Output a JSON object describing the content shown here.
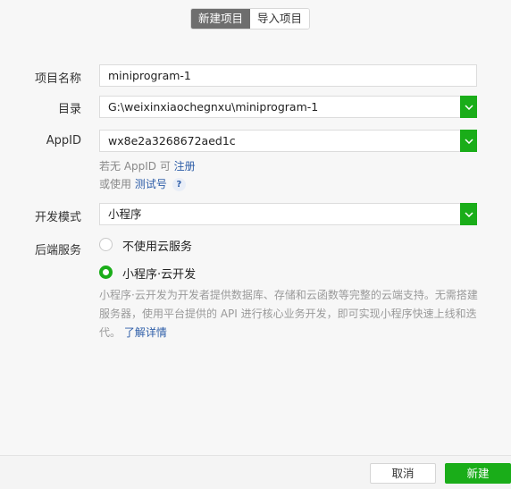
{
  "tabs": [
    {
      "label": "新建项目",
      "active": true
    },
    {
      "label": "导入项目",
      "active": false
    }
  ],
  "form": {
    "name_label": "项目名称",
    "name_value": "miniprogram-1",
    "dir_label": "目录",
    "dir_value": "G:\\weixinxiaochegnxu\\miniprogram-1",
    "appid_label": "AppID",
    "appid_value": "wx8e2a3268672aed1c",
    "appid_hint_prefix": "若无 AppID 可 ",
    "appid_hint_link": "注册",
    "test_hint_prefix": "或使用 ",
    "test_hint_link": "测试号",
    "help_glyph": "?",
    "mode_label": "开发模式",
    "mode_value": "小程序",
    "backend_label": "后端服务",
    "radio_no_cloud": "不使用云服务",
    "radio_cloud": "小程序·云开发",
    "cloud_desc": "小程序·云开发为开发者提供数据库、存储和云函数等完整的云端支持。无需搭建服务器，使用平台提供的 API 进行核心业务开发，即可实现小程序快速上线和迭代。",
    "learn_more": "了解详情"
  },
  "footer": {
    "cancel_label": "取消",
    "create_label": "新建"
  },
  "colors": {
    "accent": "#1aad19",
    "link": "#2e5ea8"
  }
}
